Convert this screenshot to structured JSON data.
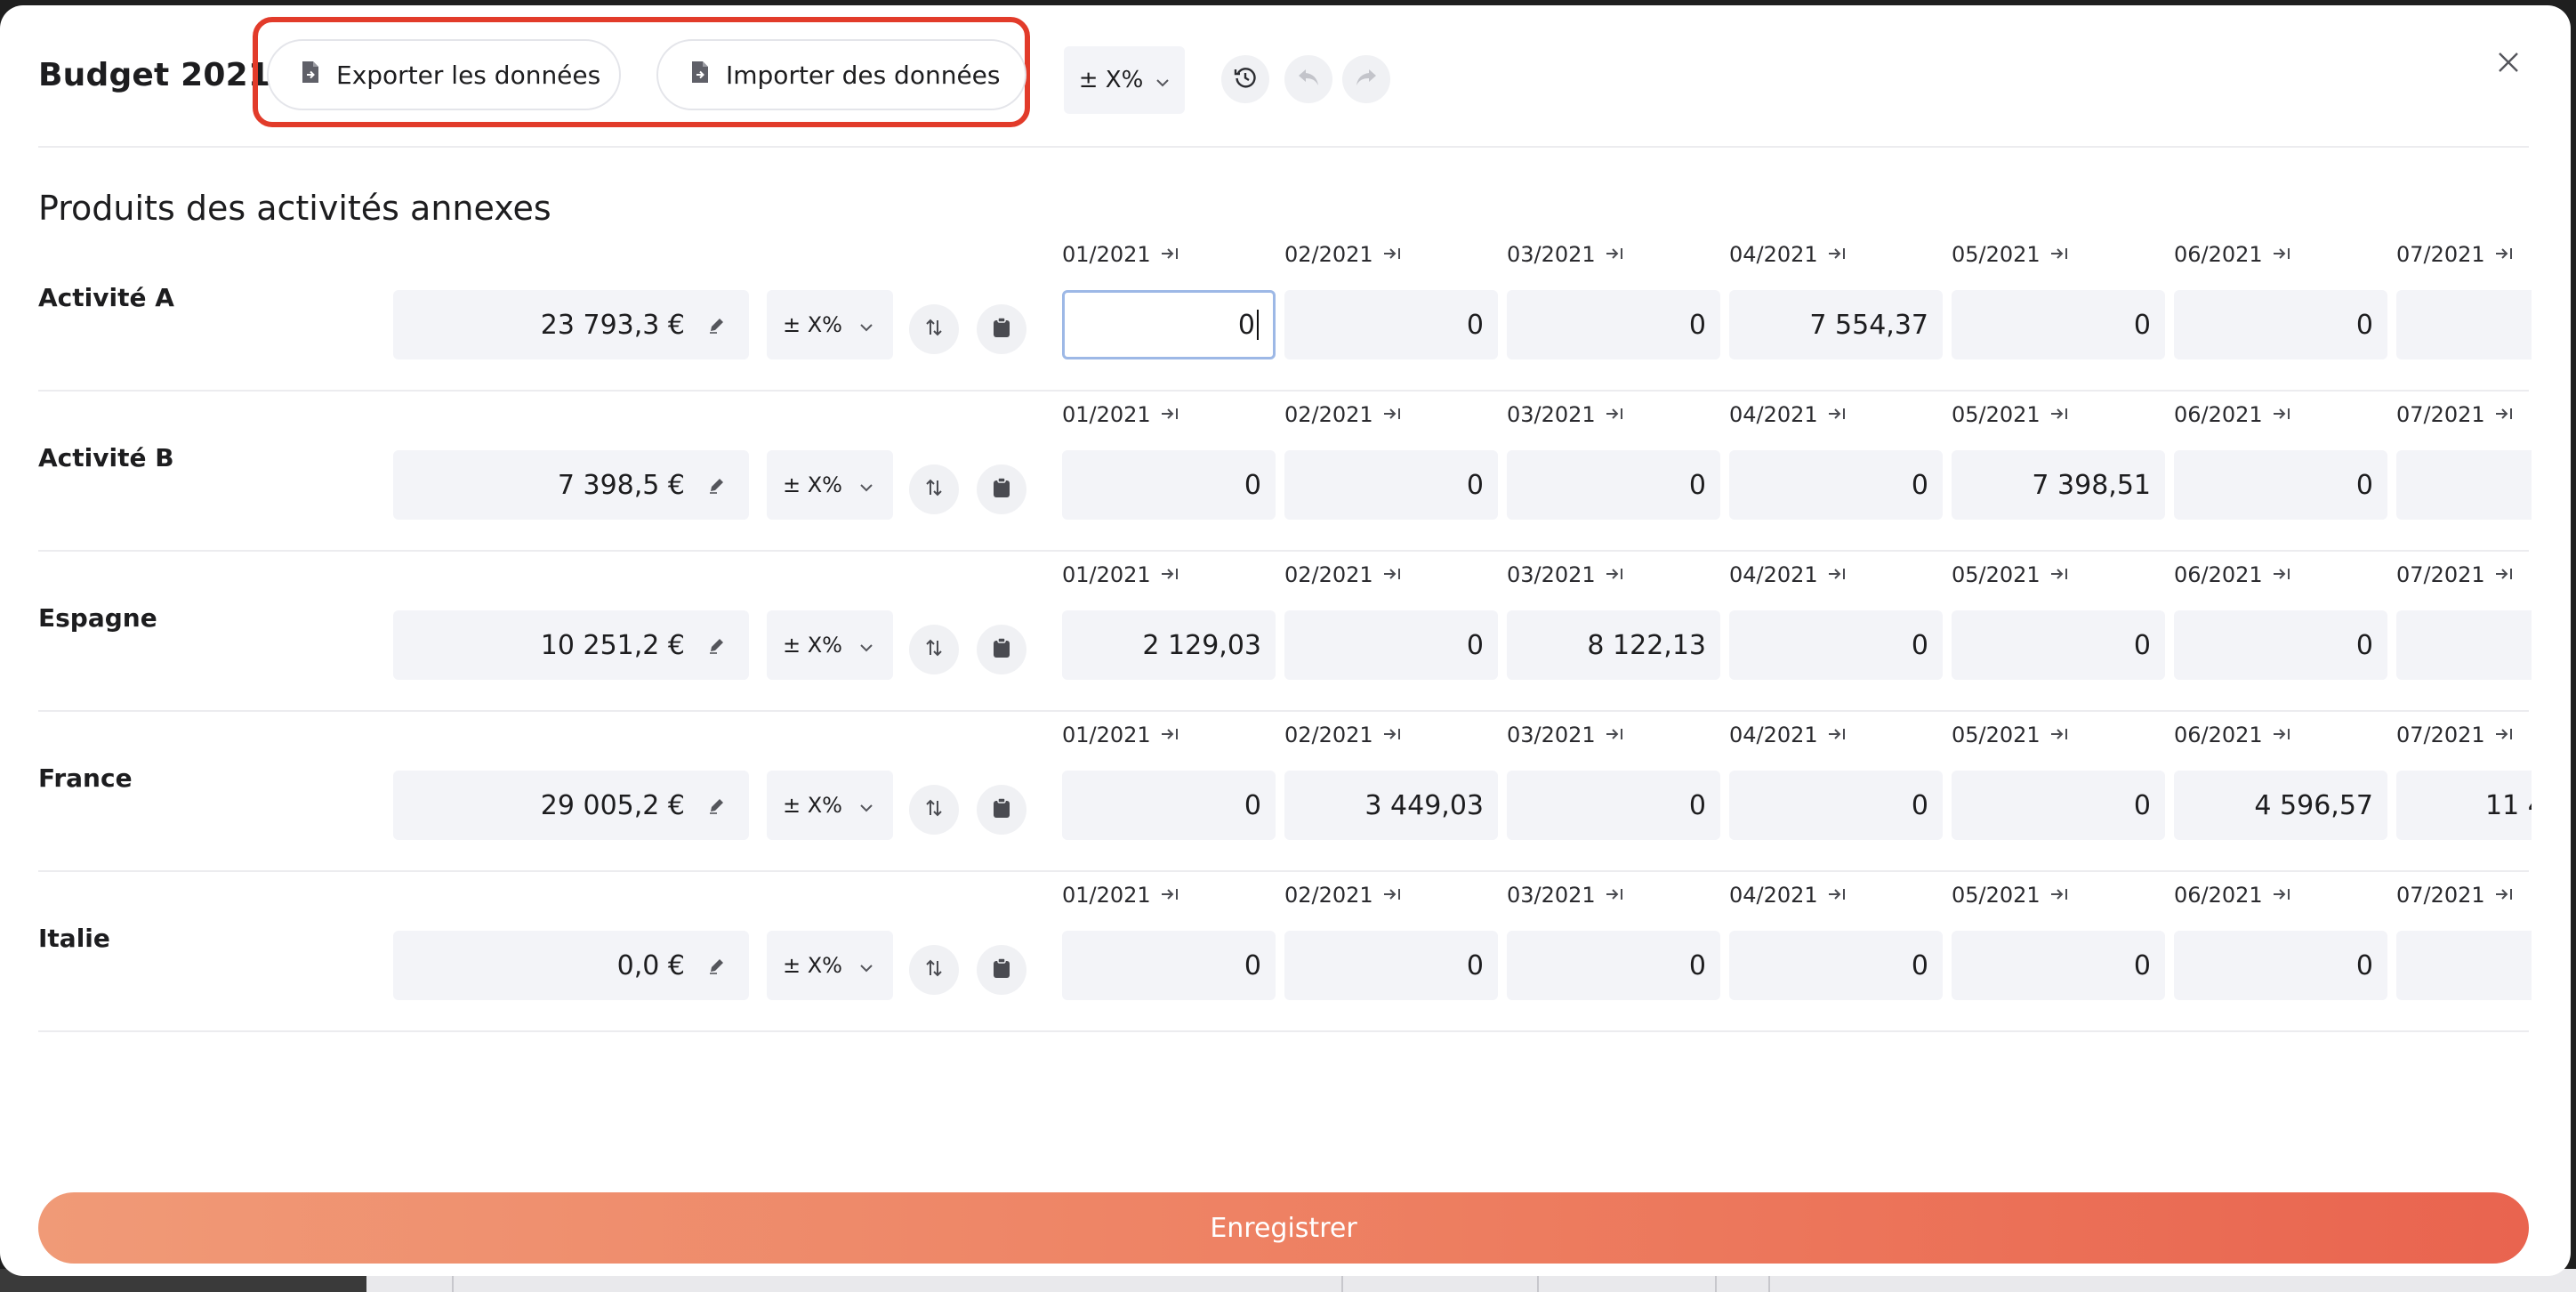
{
  "modal": {
    "title": "Budget 2021",
    "export_label": "Exporter les données",
    "import_label": "Importer des données",
    "percent_label": "± X%",
    "save_label": "Enregistrer"
  },
  "section": {
    "title": "Produits des activités annexes"
  },
  "rows": [
    {
      "label": "Activité A",
      "total": "23 793,3 €",
      "percent": "± X%",
      "months": [
        "01/2021",
        "02/2021",
        "03/2021",
        "04/2021",
        "05/2021",
        "06/2021",
        "07/2021"
      ],
      "values": [
        "0",
        "0",
        "0",
        "7 554,37",
        "0",
        "0",
        ""
      ]
    },
    {
      "label": "Activité B",
      "total": "7 398,5 €",
      "percent": "± X%",
      "months": [
        "01/2021",
        "02/2021",
        "03/2021",
        "04/2021",
        "05/2021",
        "06/2021",
        "07/2021"
      ],
      "values": [
        "0",
        "0",
        "0",
        "0",
        "7 398,51",
        "0",
        ""
      ]
    },
    {
      "label": "Espagne",
      "total": "10 251,2 €",
      "percent": "± X%",
      "months": [
        "01/2021",
        "02/2021",
        "03/2021",
        "04/2021",
        "05/2021",
        "06/2021",
        "07/2021"
      ],
      "values": [
        "2 129,03",
        "0",
        "8 122,13",
        "0",
        "0",
        "0",
        ""
      ]
    },
    {
      "label": "France",
      "total": "29 005,2 €",
      "percent": "± X%",
      "months": [
        "01/2021",
        "02/2021",
        "03/2021",
        "04/2021",
        "05/2021",
        "06/2021",
        "07/2021"
      ],
      "values": [
        "0",
        "3 449,03",
        "0",
        "0",
        "0",
        "4 596,57",
        "11 4"
      ]
    },
    {
      "label": "Italie",
      "total": "0,0 €",
      "percent": "± X%",
      "months": [
        "01/2021",
        "02/2021",
        "03/2021",
        "04/2021",
        "05/2021",
        "06/2021",
        "07/2021"
      ],
      "values": [
        "0",
        "0",
        "0",
        "0",
        "0",
        "0",
        ""
      ]
    }
  ],
  "colors": {
    "accent_start": "#f09a77",
    "accent_end": "#e9644f",
    "highlight_border": "#e23b2a",
    "field_background": "#f3f4f8",
    "focus_border": "#9db8e6"
  },
  "icons": {
    "export": "file-arrow-icon",
    "import": "file-arrow-icon",
    "history": "history-icon",
    "undo": "undo-icon",
    "redo": "redo-icon",
    "close": "close-icon",
    "edit": "pencil-icon",
    "sort": "sort-arrows-icon",
    "clipboard": "clipboard-icon",
    "month_action": "arrow-to-right-icon",
    "dropdown": "chevron-down-icon"
  }
}
